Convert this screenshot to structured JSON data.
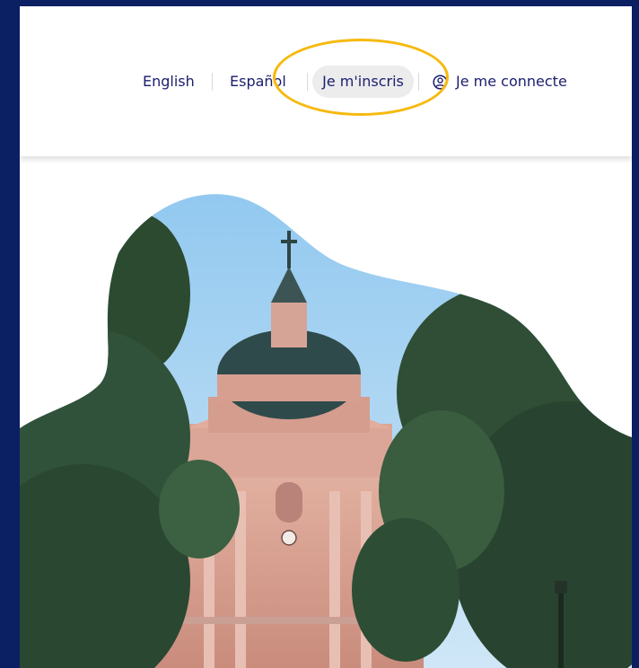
{
  "nav": {
    "lang_english": "English",
    "lang_spanish": "Español",
    "signup_label": "Je m'inscris",
    "login_label": "Je me connecte"
  },
  "icons": {
    "login": "user-circle-icon"
  },
  "colors": {
    "page_background": "#0b1f63",
    "nav_text": "#1a1e6e",
    "highlight": "#f6b90d",
    "signup_pill": "#ececec"
  },
  "hero": {
    "image_subject": "domed building framed by trees"
  }
}
